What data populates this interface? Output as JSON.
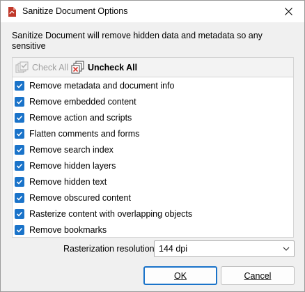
{
  "window": {
    "title": "Sanitize Document Options",
    "app_icon": "pdf-app-icon",
    "close_icon": "close-icon"
  },
  "description": "Sanitize Document will remove hidden data and metadata so any sensitive\ninformation will not be published with your PDF. Choose an option to be",
  "toolbar": {
    "check_all_label": "Check All",
    "check_all_enabled": false,
    "uncheck_all_label": "Uncheck All"
  },
  "options": [
    {
      "label": "Remove metadata and document info",
      "checked": true
    },
    {
      "label": "Remove embedded content",
      "checked": true
    },
    {
      "label": "Remove action and scripts",
      "checked": true
    },
    {
      "label": "Flatten comments and forms",
      "checked": true
    },
    {
      "label": "Remove search index",
      "checked": true
    },
    {
      "label": "Remove hidden layers",
      "checked": true
    },
    {
      "label": "Remove hidden text",
      "checked": true
    },
    {
      "label": "Remove obscured content",
      "checked": true
    },
    {
      "label": "Rasterize content with overlapping objects",
      "checked": true
    },
    {
      "label": "Remove bookmarks",
      "checked": true
    }
  ],
  "rasterization": {
    "label": "Rasterization resolution:",
    "value": "144 dpi"
  },
  "buttons": {
    "ok": "OK",
    "cancel": "Cancel"
  },
  "colors": {
    "accent": "#1a73c9",
    "app_icon_red": "#c0392b"
  }
}
